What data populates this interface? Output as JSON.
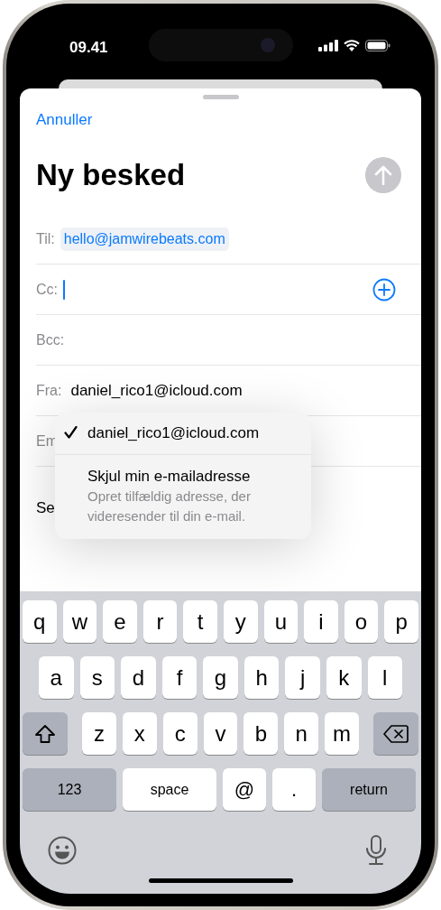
{
  "status_bar": {
    "time": "09.41"
  },
  "sheet": {
    "cancel": "Annuller",
    "title": "Ny besked",
    "send_enabled": false
  },
  "fields": [
    {
      "label": "Til:",
      "kind": "token",
      "value": "hello@jamwirebeats.com"
    },
    {
      "label": "Cc:",
      "kind": "cursor"
    },
    {
      "label": "Bcc:",
      "kind": "plain"
    },
    {
      "label": "Fra:",
      "kind": "plain",
      "value": "daniel_rico1@icloud.com"
    },
    {
      "label": "Em",
      "kind": "plain"
    }
  ],
  "subject_label": "Se",
  "from_menu": [
    {
      "title": "daniel_rico1@icloud.com",
      "selected": true
    },
    {
      "title": "Skjul min e-mailadresse",
      "subtitle": "Opret tilfældig adresse, der videresender til din e-mail.",
      "selected": false
    }
  ],
  "keyboard": {
    "rows": [
      [
        {
          "kind": "letter",
          "label": "q"
        },
        {
          "kind": "letter",
          "label": "w"
        },
        {
          "kind": "letter",
          "label": "e"
        },
        {
          "kind": "letter",
          "label": "r"
        },
        {
          "kind": "letter",
          "label": "t"
        },
        {
          "kind": "letter",
          "label": "y"
        },
        {
          "kind": "letter",
          "label": "u"
        },
        {
          "kind": "letter",
          "label": "i"
        },
        {
          "kind": "letter",
          "label": "o"
        },
        {
          "kind": "letter",
          "label": "p"
        }
      ],
      [
        {
          "kind": "letter",
          "label": "a"
        },
        {
          "kind": "letter",
          "label": "s"
        },
        {
          "kind": "letter",
          "label": "d"
        },
        {
          "kind": "letter",
          "label": "f"
        },
        {
          "kind": "letter",
          "label": "g"
        },
        {
          "kind": "letter",
          "label": "h"
        },
        {
          "kind": "letter",
          "label": "j"
        },
        {
          "kind": "letter",
          "label": "k"
        },
        {
          "kind": "letter",
          "label": "l"
        }
      ],
      [
        {
          "kind": "shift"
        },
        {
          "kind": "letter",
          "label": "z"
        },
        {
          "kind": "letter",
          "label": "x"
        },
        {
          "kind": "letter",
          "label": "c"
        },
        {
          "kind": "letter",
          "label": "v"
        },
        {
          "kind": "letter",
          "label": "b"
        },
        {
          "kind": "letter",
          "label": "n"
        },
        {
          "kind": "letter",
          "label": "m"
        },
        {
          "kind": "delete"
        }
      ]
    ],
    "bottom_bar": {
      "keys": [
        {
          "kind": "mode",
          "label": "123"
        },
        {
          "kind": "space",
          "label": "space"
        },
        {
          "kind": "symbol",
          "label": "@"
        },
        {
          "kind": "symbol",
          "label": "."
        },
        {
          "kind": "return",
          "label": "return"
        }
      ]
    }
  }
}
